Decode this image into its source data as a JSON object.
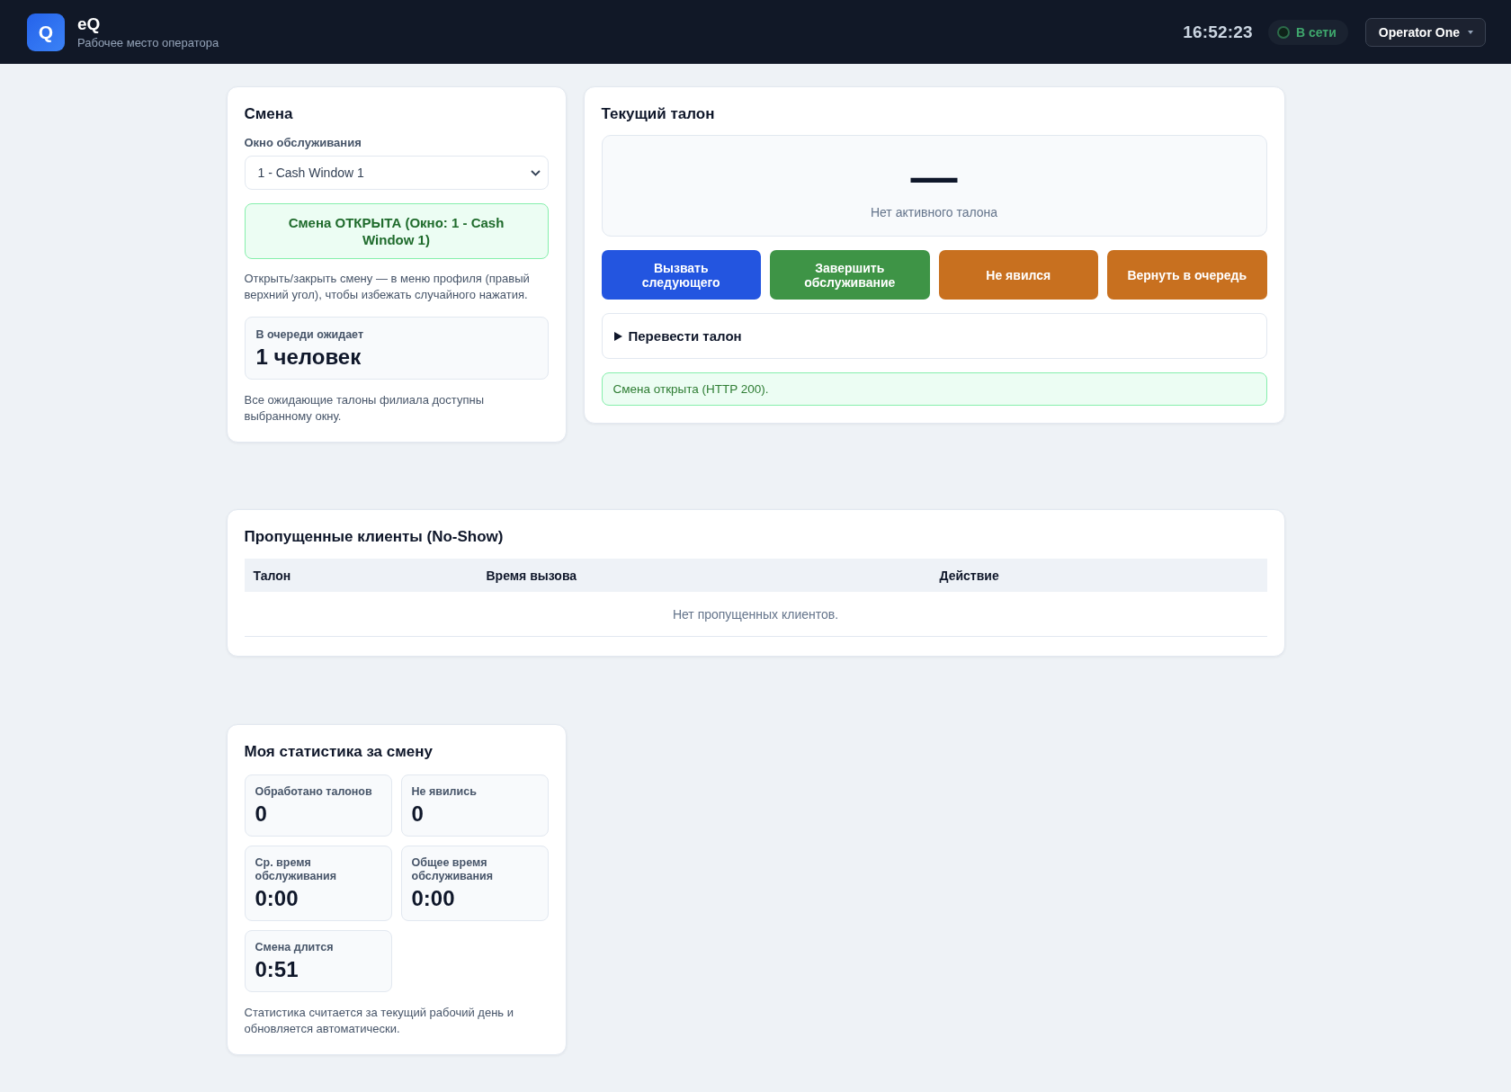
{
  "header": {
    "logo": "Q",
    "title": "eQ",
    "subtitle": "Рабочее место оператора",
    "clock": "16:52:23",
    "connection": {
      "label": "В сети",
      "online": true
    },
    "user_menu": "Operator One"
  },
  "shift": {
    "title": "Смена",
    "window_label": "Окно обслуживания",
    "window_select": {
      "value": "1 - Cash Window 1"
    },
    "status": {
      "text": "Смена ОТКРЫТА (Окно: 1 - Cash Window 1)",
      "open": true
    },
    "hint": "Открыть/закрыть смену — в меню профиля (правый верхний угол), чтобы избежать случайного нажатия.",
    "queue": {
      "label": "В очереди ожидает",
      "value": "1 человек"
    },
    "note": "Все ожидающие талоны филиала доступны выбранному окну."
  },
  "current_ticket": {
    "title": "Текущий талон",
    "number": "—",
    "caption": "Нет активного талона",
    "actions": [
      {
        "label": "Вызвать следующего",
        "kind": "primary"
      },
      {
        "label": "Завершить обслуживание",
        "kind": "success"
      },
      {
        "label": "Не явился",
        "kind": "warning"
      },
      {
        "label": "Вернуть в очередь",
        "kind": "warning"
      }
    ],
    "transfer": {
      "label": "Перевести талон",
      "expanded": false
    },
    "message": {
      "text": "Смена открыта (HTTP 200).",
      "kind": "success"
    }
  },
  "no_show": {
    "title": "Пропущенные клиенты (No-Show)",
    "columns": [
      "Талон",
      "Время вызова",
      "Действие"
    ],
    "empty_text": "Нет пропущенных клиентов."
  },
  "stats": {
    "title": "Моя статистика за смену",
    "tiles": [
      {
        "label": "Обработано талонов",
        "value": "0"
      },
      {
        "label": "Не явились",
        "value": "0"
      },
      {
        "label": "Ср. время обслуживания",
        "value": "0:00"
      },
      {
        "label": "Общее время обслуживания",
        "value": "0:00"
      },
      {
        "label": "Смена длится",
        "value": "0:51"
      }
    ],
    "note": "Статистика считается за текущий рабочий день и обновляется автоматически."
  }
}
